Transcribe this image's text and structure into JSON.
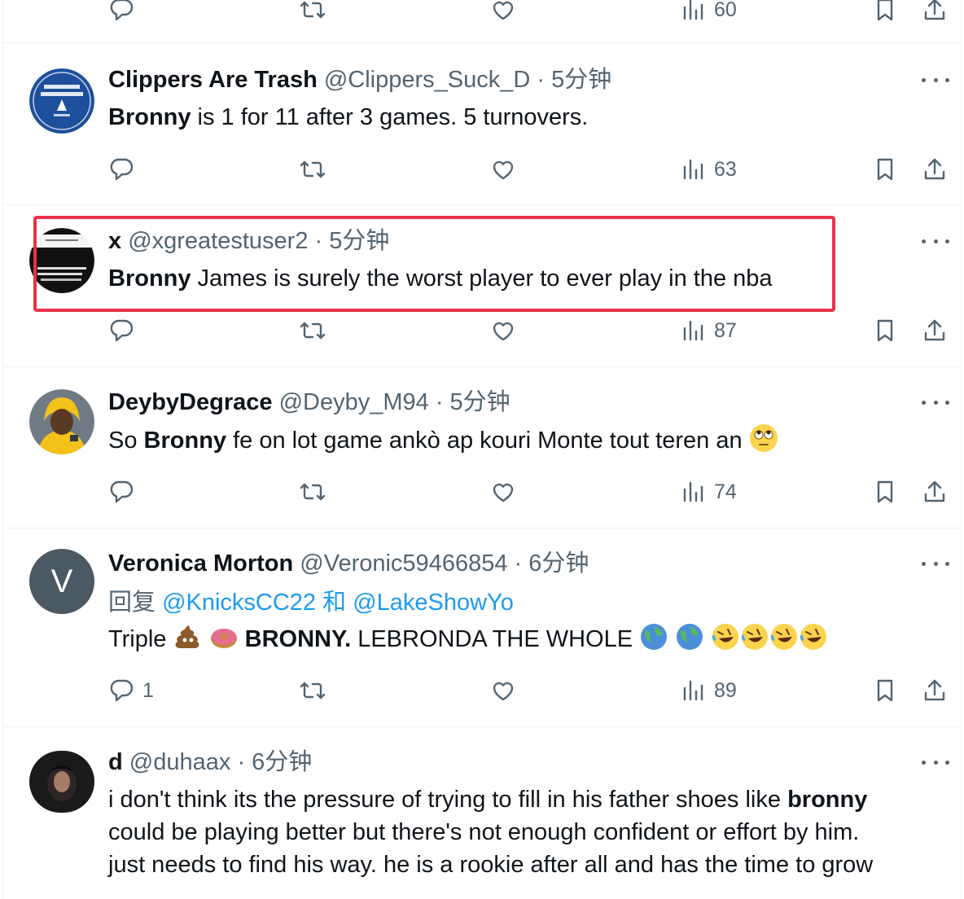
{
  "colors": {
    "accent": "#1d9bf0",
    "highlight_border": "#e8334a",
    "muted": "#536471"
  },
  "top_partial": {
    "views": "60"
  },
  "tweets": [
    {
      "name": "Clippers Are Trash",
      "handle": "@Clippers_Suck_D",
      "separator": "·",
      "time": "5分钟",
      "text_bold": "Bronny",
      "text_rest": " is 1 for 11 after 3 games. 5 turnovers.",
      "views": "63"
    },
    {
      "name": "x",
      "handle": "@xgreatestuser2",
      "separator": "·",
      "time": "5分钟",
      "text_bold": "Bronny",
      "text_rest": " James is surely the worst player to ever play in the nba",
      "views": "87"
    },
    {
      "name": "DeybyDegrace",
      "handle": "@Deyby_M94",
      "separator": "·",
      "time": "5分钟",
      "text_pre": "So ",
      "text_bold": "Bronny",
      "text_rest": " fe on lot game ankò ap kouri Monte tout teren an ",
      "emoji": "face-with-rolling-eyes",
      "views": "74"
    },
    {
      "name": "Veronica Morton",
      "handle": "@Veronic59466854",
      "separator": "·",
      "time": "6分钟",
      "avatar_letter": "V",
      "reply_prefix": "回复 ",
      "reply_user1": "@KnicksCC22",
      "reply_and": " 和 ",
      "reply_user2": "@LakeShowYo",
      "text_pre": "Triple ",
      "text_bold": "BRONNY.",
      "text_rest": " LEBRONDA THE WHOLE ",
      "replies": "1",
      "views": "89"
    },
    {
      "name": "d",
      "handle": "@duhaax",
      "separator": "·",
      "time": "6分钟",
      "line1_pre": "i don't think its the pressure of trying to fill in his father shoes like ",
      "line1_bold": "bronny",
      "line2": "could be playing better but there's not enough confident or effort by him.",
      "line3": "just needs to find his way. he is a rookie after all and has the time to grow"
    }
  ]
}
